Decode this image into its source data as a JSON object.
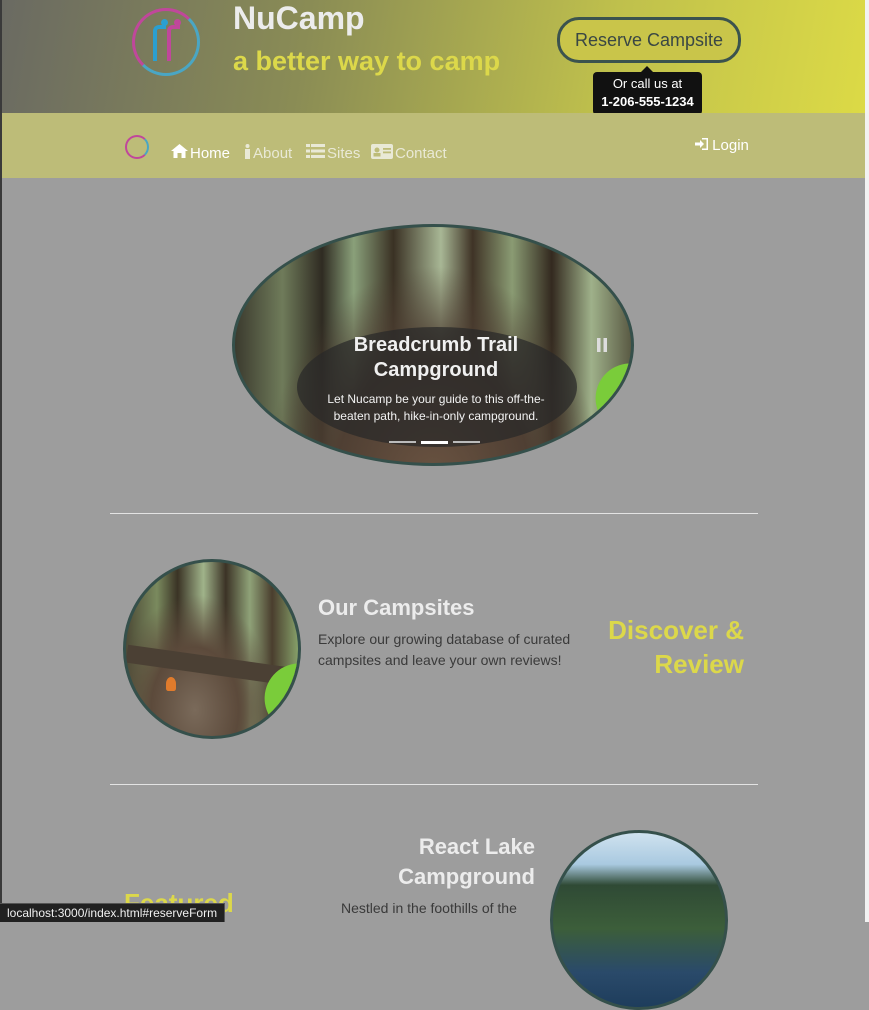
{
  "header": {
    "brand_title": "NuCamp",
    "tagline": "a better way to camp",
    "reserve_button_label": "Reserve Campsite",
    "tooltip_line1": "Or call us at",
    "tooltip_phone": "1-206-555-1234"
  },
  "navbar": {
    "items": [
      {
        "label": "Home",
        "icon": "home-icon",
        "active": true
      },
      {
        "label": "About",
        "icon": "info-icon",
        "active": false
      },
      {
        "label": "Sites",
        "icon": "list-icon",
        "active": false
      },
      {
        "label": "Contact",
        "icon": "address-card-icon",
        "active": false
      }
    ],
    "login_label": "Login"
  },
  "carousel": {
    "title": "Breadcrumb Trail Campground",
    "text": "Let Nucamp be your guide to this off-the-beaten path, hike-in-only campground.",
    "active_slide": 2,
    "slide_count": 3
  },
  "campsites": {
    "heading": "Our Campsites",
    "body": "Explore our growing database of curated campsites and leave your own reviews!",
    "accent": "Discover & Review"
  },
  "featured": {
    "heading": "React Lake Campground",
    "body": "Nestled in the foothills of the",
    "accent": "Featured"
  },
  "status_bar": {
    "url": "localhost:3000/index.html#reserveForm"
  },
  "colors": {
    "accent_yellow": "#dcd84a",
    "navbar_bg": "#bdbc78",
    "page_bg": "#9d9d9d",
    "border_teal": "#35504b"
  }
}
